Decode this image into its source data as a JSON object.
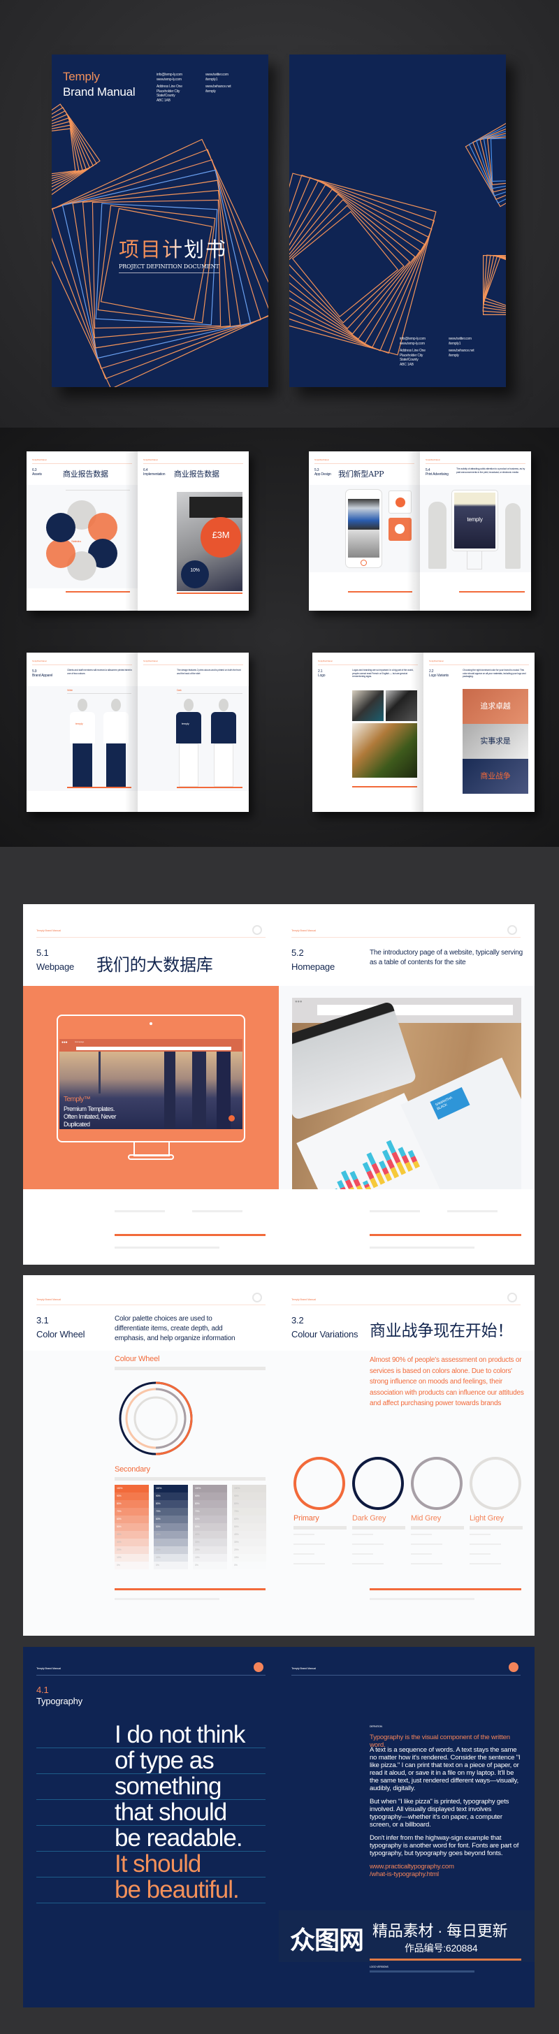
{
  "cover": {
    "brand": "Temply",
    "title": "Brand Manual",
    "email": "info@temp-ly.com",
    "web": "www.temp-ly.com",
    "address": [
      "Address Line One",
      "Placeholder City",
      "State/County",
      "ABC 1AB"
    ],
    "twitter": [
      "www.twitter.com",
      "/temply1"
    ],
    "behance": [
      "www.behance.net",
      "/temply"
    ],
    "cn_title": "项目计划书",
    "subtitle": "PROJECT DEFINITION DOCUMENT"
  },
  "colors": {
    "navy": "#0f2453",
    "orange": "#f26a3a",
    "panel_orange": "#f4845a",
    "mid_grey": "#a79fa6",
    "light_grey": "#e1dfdc"
  },
  "header": "Temply Brand Manual",
  "mini_spreads": [
    {
      "left": {
        "num": "6.3",
        "title": "Assets",
        "cn": "商业报告数据",
        "label": "Statistics"
      },
      "right": {
        "num": "6.4",
        "title": "Implementation",
        "cn": "商业报告数据",
        "stat1": "£3M",
        "stat2": "10%"
      }
    },
    {
      "left": {
        "num": "5.3",
        "title": "App Design",
        "cn": "我们新型APP"
      },
      "right": {
        "num": "5.4",
        "title": "Print Advertising",
        "desc": "The activity of attracting public attention to a product or business, as by paid announcements in the print, broadcast, or electronic media",
        "billboard": "temply"
      }
    },
    {
      "left": {
        "num": "5.9",
        "title": "Brand Apparel",
        "desc": "Clients and staff members will received a silkscreen printed tshirt in one of two colours",
        "label": "White",
        "logo": "temply"
      },
      "right": {
        "desc": "The design features 2 print colours and is printed on both the front and the back of the shirt",
        "label": "Dark",
        "logo": "temply"
      }
    },
    {
      "left": {
        "num": "2.1",
        "title": "Logo",
        "desc": "Logos and branding are so important. In a big part of the world, people cannot read French or English — but are great at remembering signs."
      },
      "right": {
        "num": "2.2",
        "title": "Logo Variants",
        "desc": "Choosing the right dominant color for your brand is crucial. This color should appear on all your materials, including your logo and packaging.",
        "banners": [
          "追求卓越",
          "实事求是",
          "商业战争"
        ]
      }
    }
  ],
  "webpage": {
    "num": "5.1",
    "title": "Webpage",
    "cn": "我们的大数据库",
    "screen_brand": "Temply™",
    "screen_text": [
      "Premium Templates.",
      "Often Imitated, Never",
      "Duplicated"
    ],
    "tab": "Homepage",
    "num2": "5.2",
    "title2": "Homepage",
    "desc2": "The introductory page of a website, typically serving as a table of contents for the site",
    "resume_name": "SAMANTHA BLACK"
  },
  "colour": {
    "num": "3.1",
    "title": "Color Wheel",
    "desc": "Color palette choices are used to differentiate items, create depth, add emphasis, and help organize information",
    "wheel_label": "Colour Wheel",
    "secondary_label": "Secondary",
    "percentages": [
      "100%",
      "90%",
      "80%",
      "70%",
      "60%",
      "50%",
      "40%",
      "30%",
      "20%",
      "10%",
      "0%"
    ],
    "num2": "3.2",
    "title2": "Colour Variations",
    "cn": "商业战争现在开始！",
    "para": "Almost 90% of people's assessment on products or services is based on colors alone. Due to colors' strong influence on moods and feelings, their association with products can influence our attitudes and affect purchasing power towards brands",
    "swatches": [
      {
        "name": "Primary",
        "color": "#f26a3a"
      },
      {
        "name": "Dark Grey",
        "color": "#0e1a3f"
      },
      {
        "name": "Mid Grey",
        "color": "#a79fa6"
      },
      {
        "name": "Light Grey",
        "color": "#e1dfdc"
      }
    ]
  },
  "typography": {
    "num": "4.1",
    "title": "Typography",
    "quote": [
      "I do not think",
      "of type as",
      "something",
      "that should",
      "be readable.",
      "It should",
      "be beautiful."
    ],
    "label": "DEFINITION",
    "heading": "Typography is the visual component of the written word.",
    "p1": "A text is a sequence of words. A text stays the same no matter how it's rendered. Consider the sentence \"I like pizza.\" I can print that text on a piece of paper, or read it aloud, or save it in a file on my laptop. It'll be the same text, just rendered different ways—visually, audibly, digitally.",
    "p2": "But when \"I like pizza\" is printed, typography gets involved. All visually displayed text involves typography—whether it's on paper, a computer screen, or a billboard.",
    "p3": "Don't infer from the highway-sign example that typography is another word for font. Fonts are part of typography, but typography goes beyond fonts.",
    "link": [
      "www.practicaltypography.com",
      "/what-is-typography.html"
    ],
    "footer_label": "LOGO VERSIONS"
  },
  "watermark": {
    "logo": "众图网",
    "slogan": "精品素材 · 每日更新",
    "id": "作品编号:620884"
  }
}
